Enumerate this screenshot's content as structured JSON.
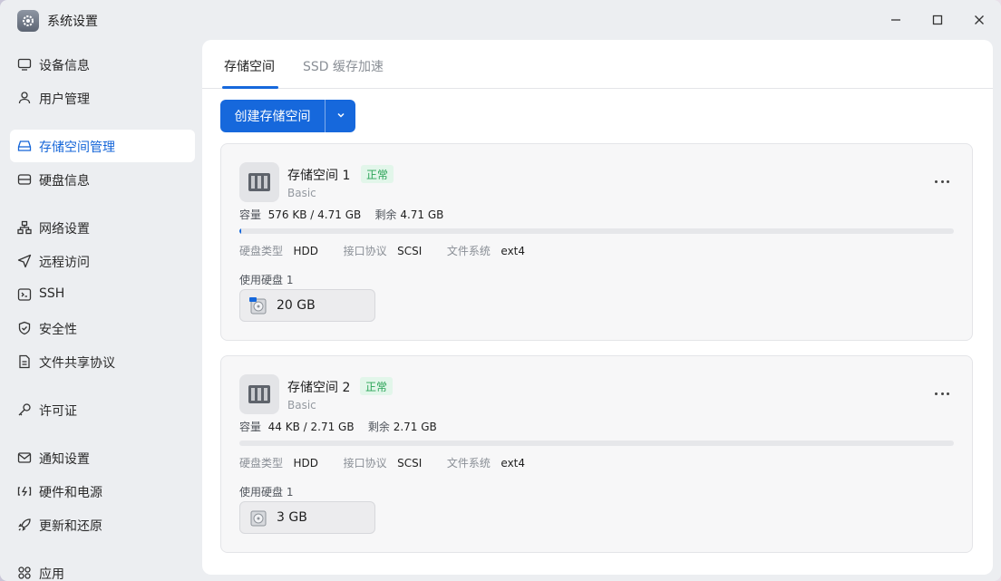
{
  "window": {
    "title": "系统设置"
  },
  "sidebar": {
    "items": [
      {
        "label": "设备信息",
        "icon": "info-icon",
        "active": false
      },
      {
        "label": "用户管理",
        "icon": "user-icon",
        "active": false
      },
      {
        "label": "存储空间管理",
        "icon": "storage-icon",
        "active": true
      },
      {
        "label": "硬盘信息",
        "icon": "disk-icon",
        "active": false
      },
      {
        "label": "网络设置",
        "icon": "network-icon",
        "active": false
      },
      {
        "label": "远程访问",
        "icon": "send-icon",
        "active": false
      },
      {
        "label": "SSH",
        "icon": "terminal-icon",
        "active": false
      },
      {
        "label": "安全性",
        "icon": "shield-icon",
        "active": false
      },
      {
        "label": "文件共享协议",
        "icon": "file-icon",
        "active": false
      },
      {
        "label": "许可证",
        "icon": "key-icon",
        "active": false
      },
      {
        "label": "通知设置",
        "icon": "mail-icon",
        "active": false
      },
      {
        "label": "硬件和电源",
        "icon": "power-icon",
        "active": false
      },
      {
        "label": "更新和还原",
        "icon": "rocket-icon",
        "active": false
      },
      {
        "label": "应用",
        "icon": "apps-icon",
        "active": false
      }
    ]
  },
  "tabs": [
    {
      "label": "存储空间",
      "active": true
    },
    {
      "label": "SSD 缓存加速",
      "active": false
    }
  ],
  "toolbar": {
    "create_label": "创建存储空间"
  },
  "pools": [
    {
      "name": "存储空间 1",
      "status": "正常",
      "type": "Basic",
      "capacity_label": "容量",
      "used": "576 KB",
      "total": "4.71 GB",
      "remaining_label": "剩余",
      "remaining": "4.71 GB",
      "usage_fraction": 0.001,
      "disk_type_label": "硬盘类型",
      "disk_type": "HDD",
      "interface_label": "接口协议",
      "interface": "SCSI",
      "fs_label": "文件系统",
      "fs": "ext4",
      "used_disks_label": "使用硬盘 1",
      "disk_size": "20 GB"
    },
    {
      "name": "存储空间 2",
      "status": "正常",
      "type": "Basic",
      "capacity_label": "容量",
      "used": "44 KB",
      "total": "2.71 GB",
      "remaining_label": "剩余",
      "remaining": "2.71 GB",
      "usage_fraction": 0.0,
      "disk_type_label": "硬盘类型",
      "disk_type": "HDD",
      "interface_label": "接口协议",
      "interface": "SCSI",
      "fs_label": "文件系统",
      "fs": "ext4",
      "used_disks_label": "使用硬盘 1",
      "disk_size": "3 GB"
    }
  ],
  "colors": {
    "accent": "#1668dc",
    "status_ok": "#2aa457",
    "status_ok_bg": "#e2f6ea"
  }
}
